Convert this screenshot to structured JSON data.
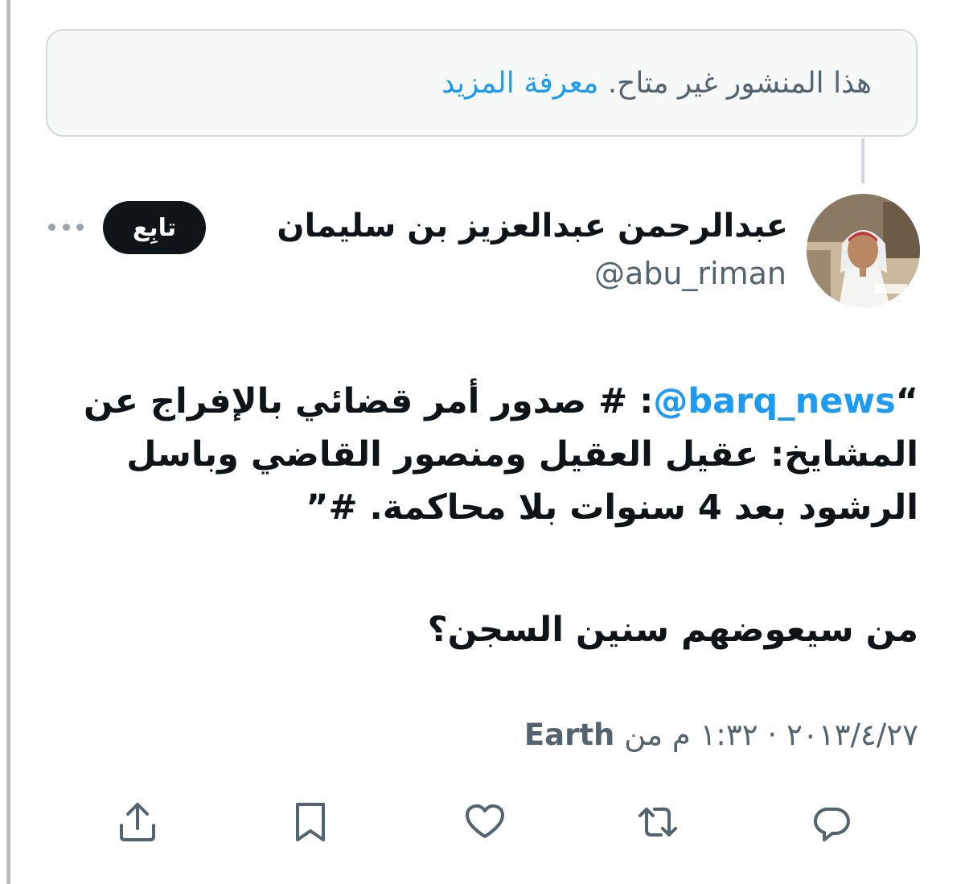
{
  "notice": {
    "text": "هذا المنشور غير متاح.",
    "link": "معرفة المزيد"
  },
  "author": {
    "display_name": "عبدالرحمن عبدالعزيز بن سليمان",
    "handle": "@abu_riman",
    "follow_label": "تابِع"
  },
  "tweet": {
    "quote_open": "“",
    "mention": "@barq_news",
    "line1_rest": ": # صدور أمر قضائي بالإفراج عن",
    "line2": "المشايخ: عقيل العقيل ومنصور القاضي وباسل",
    "line3": "الرشود بعد 4 سنوات بلا محاكمة. #”",
    "question": "من سيعوضهم سنين السجن؟"
  },
  "meta": {
    "timestamp": "٢٠١٣/٤/٢٧ · ١:٣٢ م من",
    "source": "Earth"
  },
  "icons": {
    "more": "more-horizontal-icon",
    "reply": "reply-icon",
    "retweet": "retweet-icon",
    "like": "heart-icon",
    "bookmark": "bookmark-icon",
    "share": "share-icon"
  },
  "colors": {
    "accent": "#1d9bf0",
    "text": "#0f1419",
    "secondary": "#536471"
  }
}
